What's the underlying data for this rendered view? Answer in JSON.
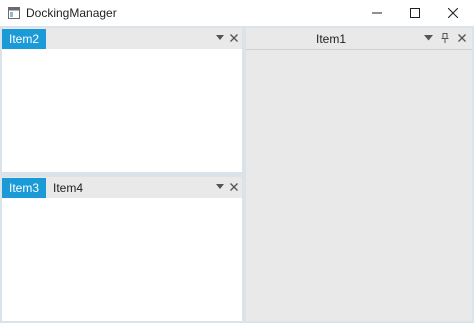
{
  "window": {
    "title": "DockingManager",
    "icon": "app-window-icon",
    "controls": [
      "minimize-icon",
      "maximize-icon",
      "close-icon"
    ]
  },
  "panes": {
    "top_left": {
      "tabs": [
        {
          "label": "Item2",
          "active": true
        }
      ],
      "actions": [
        "dropdown-arrow-icon",
        "close-icon"
      ]
    },
    "bottom_left": {
      "tabs": [
        {
          "label": "Item3",
          "active": true
        },
        {
          "label": "Item4",
          "active": false
        }
      ],
      "actions": [
        "dropdown-arrow-icon",
        "close-icon"
      ]
    },
    "right": {
      "title": "Item1",
      "actions": [
        "dropdown-arrow-icon",
        "pin-icon",
        "close-icon"
      ]
    }
  },
  "colors": {
    "accent": "#1a9ad6",
    "header_bg": "#e9e9e9",
    "frame_bg": "#dbe3ea"
  }
}
